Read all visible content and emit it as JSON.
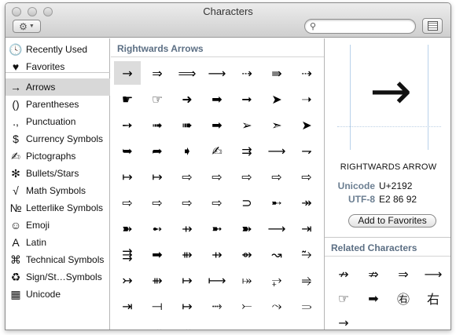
{
  "window": {
    "title": "Characters"
  },
  "toolbar": {
    "gear_icon": "gear-icon",
    "search_placeholder": "",
    "search_value": "",
    "view_icon": "character-grid-icon"
  },
  "sidebar": {
    "items": [
      {
        "icon": "🕓",
        "label": "Recently Used"
      },
      {
        "icon": "♥",
        "label": "Favorites"
      },
      {
        "icon": "→",
        "label": "Arrows"
      },
      {
        "icon": "()",
        "label": "Parentheses"
      },
      {
        "icon": ".,",
        "label": "Punctuation"
      },
      {
        "icon": "$",
        "label": "Currency Symbols"
      },
      {
        "icon": "✍",
        "label": "Pictographs"
      },
      {
        "icon": "✻",
        "label": "Bullets/Stars"
      },
      {
        "icon": "√",
        "label": "Math Symbols"
      },
      {
        "icon": "№",
        "label": "Letterlike Symbols"
      },
      {
        "icon": "☺",
        "label": "Emoji"
      },
      {
        "icon": "A",
        "label": "Latin"
      },
      {
        "icon": "⌘",
        "label": "Technical Symbols"
      },
      {
        "icon": "♻",
        "label": "Sign/St…Symbols"
      },
      {
        "icon": "▦",
        "label": "Unicode"
      }
    ],
    "selected": "Arrows"
  },
  "grid": {
    "header": "Rightwards Arrows",
    "rows": [
      [
        "→",
        "⇒",
        "⟹",
        "⟶",
        "⇢",
        "⇛",
        "⇢"
      ],
      [
        "☛",
        "☞",
        "➜",
        "➡",
        "➞",
        "➤",
        "➝"
      ],
      [
        "➙",
        "➟",
        "➠",
        "➡",
        "➢",
        "➣",
        "➤"
      ],
      [
        "➥",
        "➦",
        "➧",
        "✍",
        "⇉",
        "⟶",
        "⇁"
      ],
      [
        "↦",
        "↦",
        "⇨",
        "⇨",
        "⇨",
        "⇨",
        "⇨"
      ],
      [
        "⇨",
        "⇨",
        "⇨",
        "⇨",
        "⊃",
        "➸",
        "↠"
      ],
      [
        "➽",
        "➻",
        "⇸",
        "➼",
        "➽",
        "⟶",
        "⇥"
      ],
      [
        "⇶",
        "➡",
        "⇻",
        "⇸",
        "⇴",
        "↝",
        "⥲"
      ],
      [
        "↣",
        "⇻",
        "↦",
        "⟼",
        "⤅",
        "⥅",
        "⥤"
      ],
      [
        "⇥",
        "⟞",
        "↦",
        "⤑",
        "⤚",
        "⤳",
        "⥰"
      ],
      [
        "↠",
        "⤁",
        "⤀",
        "⤏",
        "↣",
        "⤖",
        "⤗"
      ]
    ],
    "selected": "→"
  },
  "detail": {
    "glyph": "→",
    "name": "RIGHTWARDS ARROW",
    "unicode_label": "Unicode",
    "unicode_value": "U+2192",
    "utf8_label": "UTF-8",
    "utf8_value": "E2 86 92",
    "favorite_button": "Add to Favorites"
  },
  "related": {
    "header": "Related Characters",
    "items": [
      "↛",
      "⇏",
      "⇒",
      "⟶",
      "☞",
      "➡",
      "㊨",
      "右",
      "→"
    ]
  }
}
